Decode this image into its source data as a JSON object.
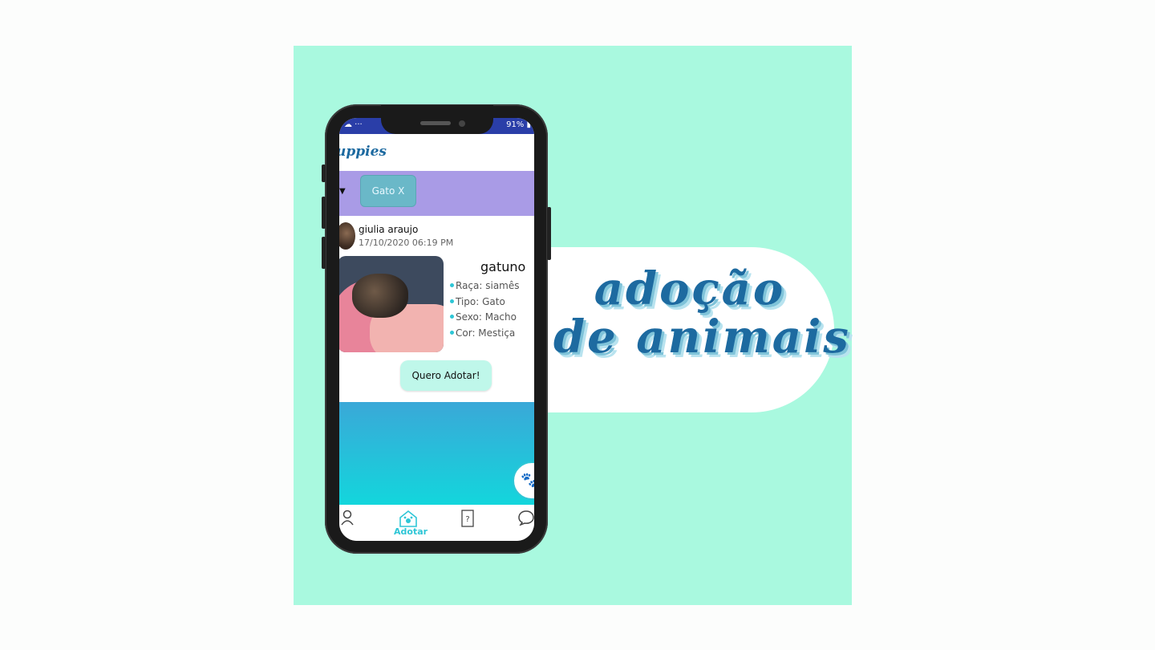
{
  "banner": {
    "line1": "adoção",
    "line2": "de animais"
  },
  "status_bar": {
    "left": "☁ ···",
    "right": "91% ▮"
  },
  "app": {
    "logo": "uppies"
  },
  "filter": {
    "chip_label": "Gato X",
    "arrow": "▼"
  },
  "post": {
    "username": "giulia araujo",
    "date": "17/10/2020 06:19 PM",
    "pet_name": "gatuno",
    "attributes": [
      "Raça: siamês",
      "Tipo: Gato",
      "Sexo: Macho",
      "Cor: Mestiça"
    ],
    "adopt_button": "Quero Adotar!"
  },
  "fab_icon": "paw-icon",
  "nav": {
    "items": [
      {
        "icon": "profile-icon",
        "label": ""
      },
      {
        "icon": "adopt-icon",
        "label": "Adotar"
      },
      {
        "icon": "question-icon",
        "label": ""
      },
      {
        "icon": "chat-icon",
        "label": ""
      }
    ]
  },
  "colors": {
    "card_bg": "#a9f9df",
    "filter_bar": "#a99be6",
    "accent": "#2ec6d6",
    "banner_text": "#1d6aa0"
  }
}
